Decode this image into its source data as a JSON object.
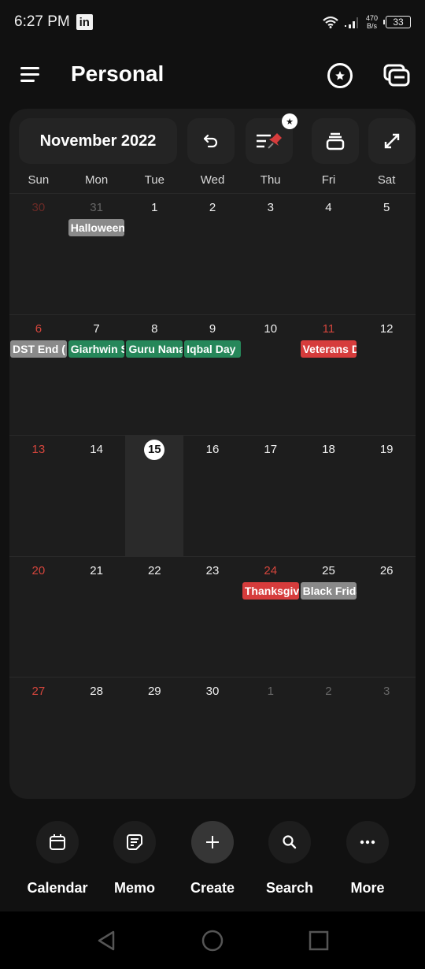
{
  "status_bar": {
    "time": "6:27 PM",
    "notification_icon": "linkedin-icon",
    "net_speed_value": "470",
    "net_speed_unit": "B/s",
    "battery": "33"
  },
  "app_bar": {
    "title": "Personal",
    "menu_icon": "menu-icon",
    "star_icon": "star-circle-icon",
    "cards_icon": "calendars-icon"
  },
  "toolbar": {
    "month_label": "November 2022",
    "buttons": [
      {
        "name": "undo",
        "icon": "undo-icon"
      },
      {
        "name": "pinned-list",
        "icon": "pin-list-icon"
      },
      {
        "name": "archive",
        "icon": "archive-icon"
      },
      {
        "name": "expand",
        "icon": "expand-icon"
      }
    ]
  },
  "weekdays": [
    "Sun",
    "Mon",
    "Tue",
    "Wed",
    "Thu",
    "Fri",
    "Sat"
  ],
  "colors": {
    "holiday_red": "#d63c3c",
    "observance_green": "#26875a",
    "event_gray": "#8a8a8a",
    "sunday_red": "#d3453c"
  },
  "weeks": [
    {
      "days": [
        {
          "num": "30",
          "other": true,
          "events": []
        },
        {
          "num": "31",
          "other": true,
          "events": [
            {
              "title": "Halloween",
              "color": "#8a8a8a"
            }
          ]
        },
        {
          "num": "1",
          "events": []
        },
        {
          "num": "2",
          "events": []
        },
        {
          "num": "3",
          "events": []
        },
        {
          "num": "4",
          "events": []
        },
        {
          "num": "5",
          "events": []
        }
      ]
    },
    {
      "days": [
        {
          "num": "6",
          "events": [
            {
              "title": "DST End (",
              "color": "#8a8a8a"
            }
          ]
        },
        {
          "num": "7",
          "events": [
            {
              "title": "Giarhwin Sharif",
              "color": "#26875a"
            }
          ]
        },
        {
          "num": "8",
          "events": [
            {
              "title": "Guru Nanak Jayanti",
              "color": "#26875a"
            }
          ]
        },
        {
          "num": "9",
          "events": [
            {
              "title": "Iqbal Day",
              "color": "#26875a"
            }
          ]
        },
        {
          "num": "10",
          "events": []
        },
        {
          "num": "11",
          "holiday": true,
          "events": [
            {
              "title": "Veterans Day",
              "color": "#d63c3c"
            }
          ]
        },
        {
          "num": "12",
          "events": []
        }
      ]
    },
    {
      "days": [
        {
          "num": "13",
          "events": []
        },
        {
          "num": "14",
          "events": []
        },
        {
          "num": "15",
          "today": true,
          "events": []
        },
        {
          "num": "16",
          "events": []
        },
        {
          "num": "17",
          "events": []
        },
        {
          "num": "18",
          "events": []
        },
        {
          "num": "19",
          "events": []
        }
      ]
    },
    {
      "days": [
        {
          "num": "20",
          "events": []
        },
        {
          "num": "21",
          "events": []
        },
        {
          "num": "22",
          "events": []
        },
        {
          "num": "23",
          "events": []
        },
        {
          "num": "24",
          "holiday": true,
          "events": [
            {
              "title": "Thanksgiving",
              "color": "#d63c3c"
            }
          ]
        },
        {
          "num": "25",
          "events": [
            {
              "title": "Black Friday",
              "color": "#8a8a8a"
            }
          ]
        },
        {
          "num": "26",
          "events": []
        }
      ]
    },
    {
      "days": [
        {
          "num": "27",
          "events": []
        },
        {
          "num": "28",
          "events": []
        },
        {
          "num": "29",
          "events": []
        },
        {
          "num": "30",
          "events": []
        },
        {
          "num": "1",
          "other": true,
          "events": []
        },
        {
          "num": "2",
          "other": true,
          "events": []
        },
        {
          "num": "3",
          "other": true,
          "events": []
        }
      ]
    }
  ],
  "bottom_nav": [
    {
      "label": "Calendar",
      "icon": "calendar-icon"
    },
    {
      "label": "Memo",
      "icon": "memo-icon"
    },
    {
      "label": "Create",
      "icon": "plus-icon"
    },
    {
      "label": "Search",
      "icon": "search-icon"
    },
    {
      "label": "More",
      "icon": "more-icon"
    }
  ],
  "system_nav": [
    "back",
    "home",
    "recents"
  ]
}
